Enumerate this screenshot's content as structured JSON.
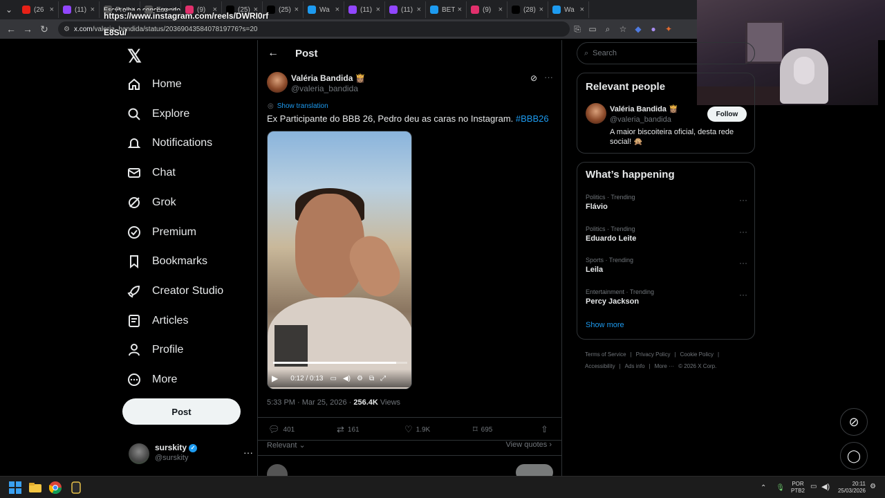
{
  "browser": {
    "tabs": [
      {
        "label": "(26",
        "color": "#e62117"
      },
      {
        "label": "(11)",
        "color": "#9146ff"
      },
      {
        "label": "Pre",
        "color": "#555555"
      },
      {
        "label": "Esc",
        "color": "#555555"
      },
      {
        "label": "(9)",
        "color": "#e1306c"
      },
      {
        "label": "(25)",
        "color": "#000000"
      },
      {
        "label": "(25)",
        "color": "#000000"
      },
      {
        "label": "Wa",
        "color": "#1d9bf0"
      },
      {
        "label": "(11)",
        "color": "#9146ff"
      },
      {
        "label": "(11)",
        "color": "#9146ff"
      },
      {
        "label": "BET",
        "color": "#1d9bf0"
      },
      {
        "label": "(9)",
        "color": "#e1306c"
      },
      {
        "label": "(28)",
        "color": "#000000"
      },
      {
        "label": "Wa",
        "color": "#1d9bf0"
      }
    ],
    "tooltip_line1": "Escut olha o concorrendo",
    "tooltip_line2": "https://www.instagram.com/reels/DWRI0rf",
    "tooltip_line3": "E8Su/",
    "url_host": "x.com",
    "url_path": "/valeria_bandida/status/2036904358407819776?s=20"
  },
  "nav": {
    "logo": "𝕏",
    "items": [
      {
        "label": "Home",
        "icon": "home-icon"
      },
      {
        "label": "Explore",
        "icon": "search-icon"
      },
      {
        "label": "Notifications",
        "icon": "bell-icon"
      },
      {
        "label": "Chat",
        "icon": "mail-icon"
      },
      {
        "label": "Grok",
        "icon": "grok-icon"
      },
      {
        "label": "Premium",
        "icon": "verified-icon"
      },
      {
        "label": "Bookmarks",
        "icon": "bookmark-icon"
      },
      {
        "label": "Creator Studio",
        "icon": "rocket-icon"
      },
      {
        "label": "Articles",
        "icon": "article-icon"
      },
      {
        "label": "Profile",
        "icon": "person-icon"
      },
      {
        "label": "More",
        "icon": "more-circle-icon"
      }
    ],
    "post_button": "Post",
    "account_name": "surskity",
    "account_handle": "@surskity"
  },
  "main": {
    "title": "Post",
    "author_name": "Valéria Bandida 👸🏽",
    "author_handle": "@valeria_bandida",
    "show_translation": "Show translation",
    "text": "Ex Participante do BBB 26, Pedro deu as caras no Instagram. ",
    "hashtag": "#BBB26",
    "video": {
      "current_time": "0:12",
      "duration": "0:13",
      "time_display": "0:12 / 0:13",
      "progress_pct": 92
    },
    "meta_time": "5:33 PM · Mar 25, 2026 · ",
    "views_count": "256.4K",
    "views_label": " Views",
    "actions": {
      "replies": "401",
      "reposts": "161",
      "likes": "1.9K",
      "bookmarks": "695"
    },
    "sort_label": "Relevant",
    "view_quotes": "View quotes"
  },
  "right": {
    "search_placeholder": "Search",
    "relevant_title": "Relevant people",
    "person_name": "Valéria Bandida 👸🏽",
    "person_handle": "@valeria_bandida",
    "follow_label": "Follow",
    "person_bio": "A maior biscoiteira oficial, desta rede social! 🙊",
    "happening_title": "What’s happening",
    "trends": [
      {
        "category": "Politics · Trending",
        "name": "Flávio"
      },
      {
        "category": "Politics · Trending",
        "name": "Eduardo Leite"
      },
      {
        "category": "Sports · Trending",
        "name": "Leila"
      },
      {
        "category": "Entertainment · Trending",
        "name": "Percy Jackson"
      }
    ],
    "show_more": "Show more",
    "footer_links": [
      "Terms of Service",
      "|",
      "Privacy Policy",
      "|",
      "Cookie Policy",
      "|"
    ],
    "footer_links2": [
      "Accessibility",
      "|",
      "Ads info",
      "|",
      "More ···",
      "© 2026 X Corp."
    ]
  },
  "taskbar": {
    "lang_line1": "POR",
    "lang_line2": "PTB2",
    "time": "20:11",
    "date": "25/03/2026"
  }
}
